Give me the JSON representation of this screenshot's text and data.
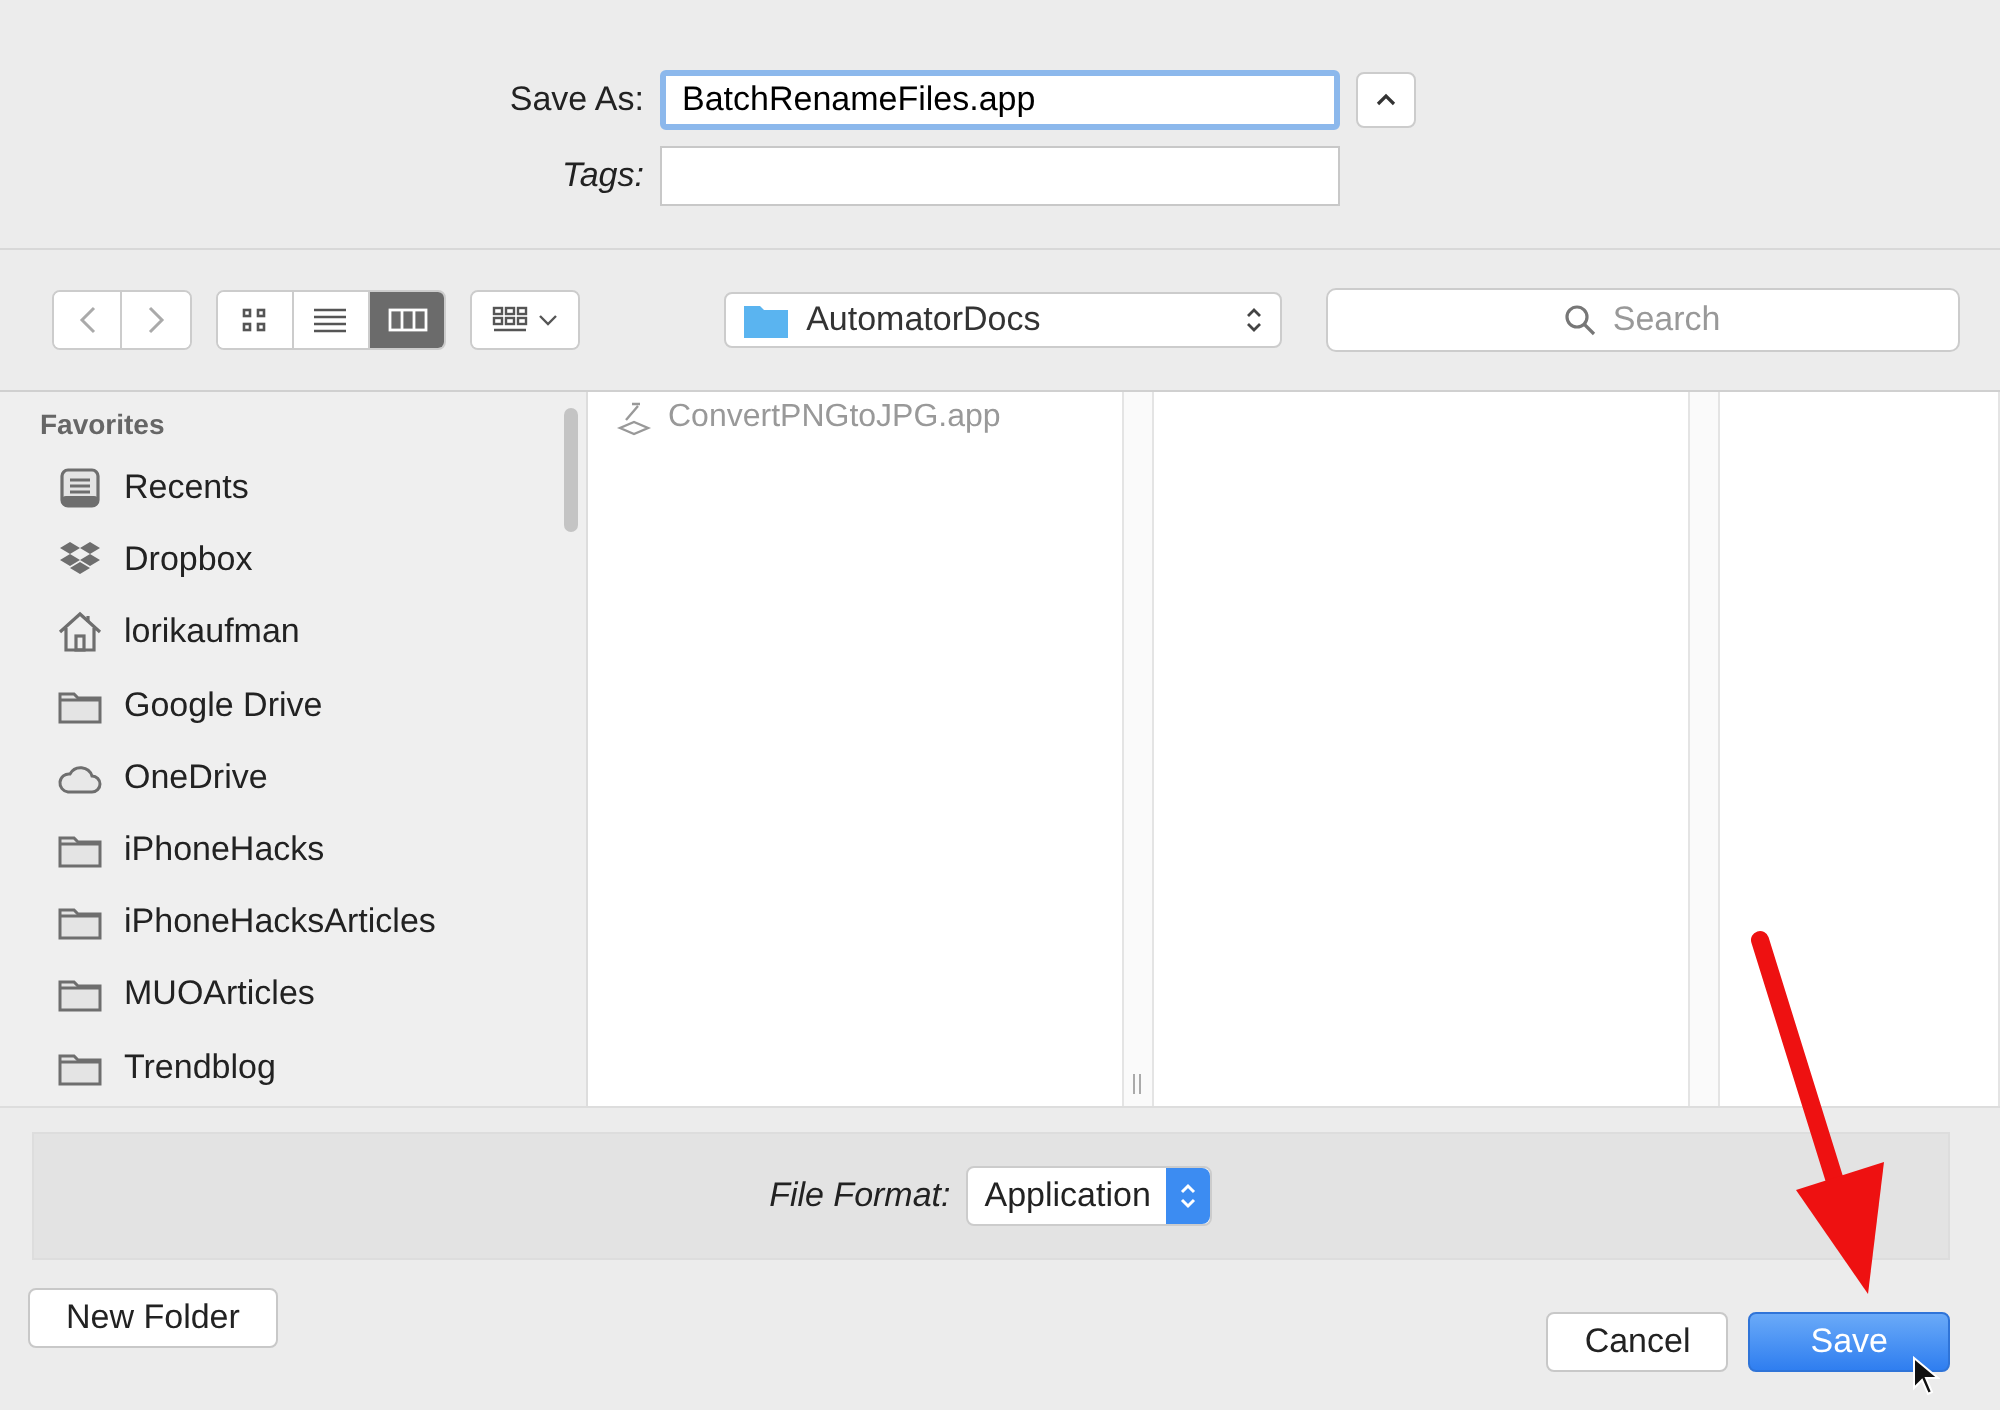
{
  "save_as": {
    "label": "Save As:",
    "value": "BatchRenameFiles.app"
  },
  "tags": {
    "label": "Tags:"
  },
  "toolbar": {
    "view_modes": [
      {
        "kind": "icons",
        "selected": false
      },
      {
        "kind": "list",
        "selected": false
      },
      {
        "kind": "columns",
        "selected": true
      }
    ],
    "location": "AutomatorDocs",
    "search": {
      "placeholder": "Search"
    }
  },
  "sidebar": {
    "heading": "Favorites",
    "items": [
      {
        "label": "Recents",
        "kind": "recents"
      },
      {
        "label": "Dropbox",
        "kind": "dropbox"
      },
      {
        "label": "lorikaufman",
        "kind": "home"
      },
      {
        "label": "Google Drive",
        "kind": "folder"
      },
      {
        "label": "OneDrive",
        "kind": "cloud"
      },
      {
        "label": "iPhoneHacks",
        "kind": "folder"
      },
      {
        "label": "iPhoneHacksArticles",
        "kind": "folder"
      },
      {
        "label": "MUOArticles",
        "kind": "folder"
      },
      {
        "label": "Trendblog",
        "kind": "folder"
      }
    ]
  },
  "browser": {
    "files": [
      {
        "name": "ConvertPNGtoJPG.app",
        "disabled": true
      }
    ]
  },
  "file_format": {
    "label": "File Format:",
    "value": "Application"
  },
  "buttons": [
    {
      "label": "New Folder",
      "kind": "secondary"
    },
    {
      "label": "Cancel",
      "kind": "secondary"
    },
    {
      "label": "Save",
      "kind": "primary"
    }
  ]
}
